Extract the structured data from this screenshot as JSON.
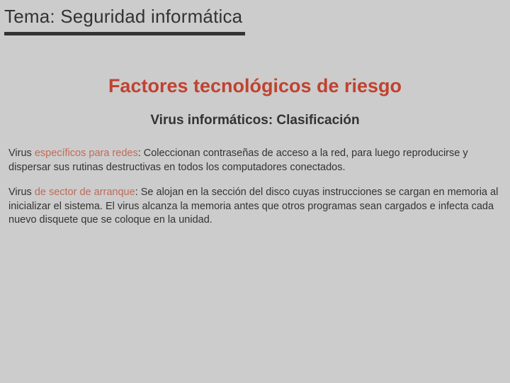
{
  "topic": {
    "label": "Tema: Seguridad informática"
  },
  "headings": {
    "main": "Factores tecnológicos de riesgo",
    "sub": "Virus informáticos: Clasificación"
  },
  "paragraphs": {
    "p1": {
      "prefix": "Virus ",
      "term": "específicos para redes",
      "rest": ": Coleccionan contraseñas de acceso a la red, para luego reproducirse y dispersar sus rutinas destructivas en todos los computadores conectados."
    },
    "p2": {
      "prefix": "Virus ",
      "term": "de sector de arranque",
      "rest": ": Se alojan en la sección del disco cuyas instrucciones se cargan en memoria al inicializar el sistema. El virus alcanza la memoria antes que otros programas sean cargados e infecta cada nuevo disquete que se coloque en la unidad."
    }
  }
}
